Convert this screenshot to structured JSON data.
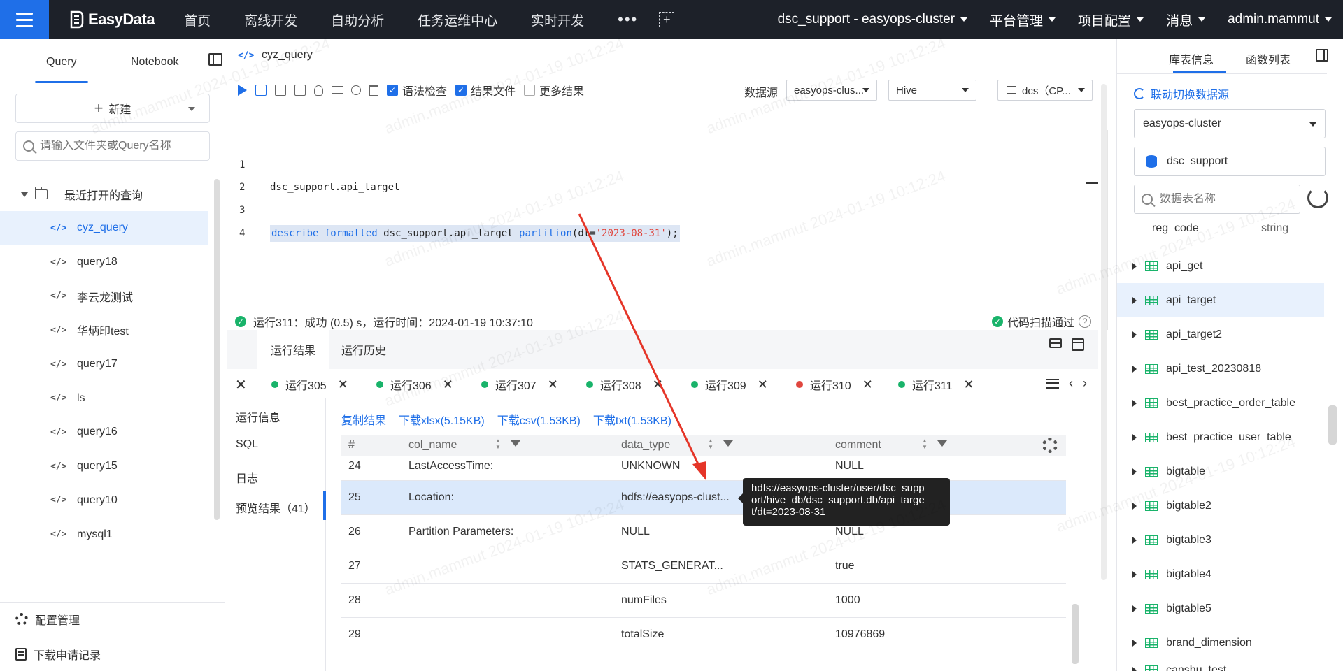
{
  "nav": {
    "logo": "EasyData",
    "items": [
      "首页",
      "离线开发",
      "自助分析",
      "任务运维中心",
      "实时开发"
    ],
    "more": "•••",
    "right": [
      "dsc_support - easyops-cluster",
      "平台管理",
      "项目配置",
      "消息",
      "admin.mammut"
    ]
  },
  "left": {
    "tabs": [
      "Query",
      "Notebook"
    ],
    "new_label": "新建",
    "search_placeholder": "请输入文件夹或Query名称",
    "recent_label": "最近打开的查询",
    "queries": [
      "cyz_query",
      "query18",
      "李云龙测试",
      "华炳印test",
      "query17",
      "ls",
      "query16",
      "query15",
      "query10",
      "mysql1"
    ],
    "footer": [
      "配置管理",
      "下载申请记录"
    ]
  },
  "editor": {
    "title": "cyz_query",
    "checks": [
      {
        "label": "语法检查",
        "checked": true
      },
      {
        "label": "结果文件",
        "checked": true
      },
      {
        "label": "更多结果",
        "checked": false
      }
    ],
    "datasource_label": "数据源",
    "datasource": "easyops-clus...",
    "engine": "Hive",
    "queue": "dcs（CP...",
    "lines": [
      {
        "n": "1"
      },
      {
        "n": "2",
        "text": "dsc_support.api_target"
      },
      {
        "n": "3"
      },
      {
        "n": "4",
        "parts": [
          "describe",
          "formatted",
          "dsc_support.api_target",
          "partition",
          "(dt=",
          "'2023-08-31'",
          ");"
        ]
      }
    ],
    "status": "运行311：成功 (0.5) s，运行时间：2024-01-19 10:37:10",
    "scan": "代码扫描通过"
  },
  "results": {
    "tabs": [
      "运行结果",
      "运行历史"
    ],
    "runs": [
      {
        "label": "运行305",
        "status": "ok"
      },
      {
        "label": "运行306",
        "status": "ok"
      },
      {
        "label": "运行307",
        "status": "ok"
      },
      {
        "label": "运行308",
        "status": "ok"
      },
      {
        "label": "运行309",
        "status": "ok"
      },
      {
        "label": "运行310",
        "status": "error"
      },
      {
        "label": "运行311",
        "status": "ok"
      }
    ],
    "sidenav": [
      "运行信息",
      "SQL",
      "日志",
      "预览结果（41）"
    ],
    "links": [
      "复制结果",
      "下载xlsx(5.15KB)",
      "下载csv(1.53KB)",
      "下载txt(1.53KB)"
    ],
    "columns": [
      "#",
      "col_name",
      "data_type",
      "comment"
    ],
    "rows": [
      [
        "24",
        "LastAccessTime:",
        "UNKNOWN",
        "NULL"
      ],
      [
        "25",
        "Location:",
        "hdfs://easyops-clust...",
        ""
      ],
      [
        "26",
        "Partition Parameters:",
        "NULL",
        "NULL"
      ],
      [
        "27",
        "",
        "STATS_GENERAT...",
        "true"
      ],
      [
        "28",
        "",
        "numFiles",
        "1000"
      ],
      [
        "29",
        "",
        "totalSize",
        "10976869"
      ]
    ],
    "tooltip": [
      "hdfs://easyops-cluster/user/dsc_supp",
      "ort/hive_db/dsc_support.db/api_targe",
      "t/dt=2023-08-31"
    ]
  },
  "right": {
    "tabs": [
      "库表信息",
      "函数列表"
    ],
    "link_switch": "联动切换数据源",
    "cluster": "easyops-cluster",
    "database": "dsc_support",
    "search_placeholder": "数据表名称",
    "field": {
      "name": "reg_code",
      "type": "string"
    },
    "tables": [
      "api_get",
      "api_target",
      "api_target2",
      "api_test_20230818",
      "best_practice_order_table",
      "best_practice_user_table",
      "bigtable",
      "bigtable2",
      "bigtable3",
      "bigtable4",
      "bigtable5",
      "brand_dimension",
      "canshu_test"
    ]
  },
  "watermark": "admin.mammut 2024-01-19 10:12:24",
  "colors": {
    "accent": "#1f6fe8",
    "nav_bg": "#1d2129",
    "success": "#19b36a",
    "error": "#e0463e"
  }
}
